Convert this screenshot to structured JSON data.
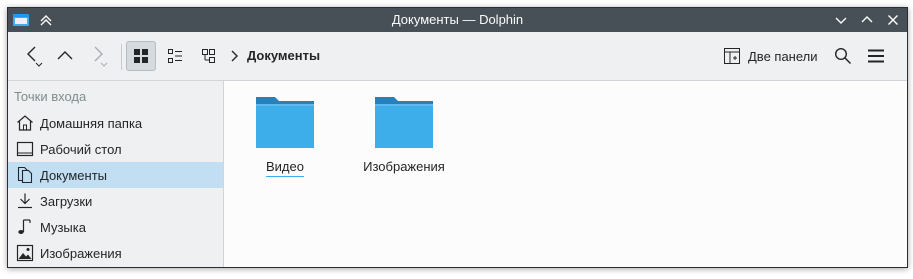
{
  "window": {
    "title": "Документы — Dolphin"
  },
  "toolbar": {
    "breadcrumb": "Документы",
    "split_label": "Две панели"
  },
  "sidebar": {
    "header": "Точки входа",
    "items": [
      {
        "label": "Домашняя папка",
        "icon": "home-icon"
      },
      {
        "label": "Рабочий стол",
        "icon": "desktop-icon"
      },
      {
        "label": "Документы",
        "icon": "documents-icon",
        "selected": true
      },
      {
        "label": "Загрузки",
        "icon": "downloads-icon"
      },
      {
        "label": "Музыка",
        "icon": "music-icon"
      },
      {
        "label": "Изображения",
        "icon": "pictures-icon"
      }
    ]
  },
  "content": {
    "items": [
      {
        "label": "Видео",
        "icon": "folder-icon"
      },
      {
        "label": "Изображения",
        "icon": "folder-icon"
      }
    ]
  },
  "colors": {
    "titlebar": "#475057",
    "selection": "#c1def3",
    "folder": "#3daee9",
    "folder_tab": "#2980b9",
    "sidebar_bg": "#eff0f1"
  }
}
